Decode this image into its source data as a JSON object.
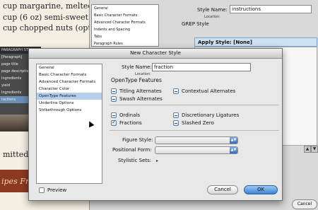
{
  "background_document": {
    "recipe_lines": [
      "cup margarine, melted",
      "cup (6 oz) semi-sweet choco",
      "cup chopped nuts (optional"
    ],
    "panel_title": "PARAGRAPH STYLES",
    "panel_items": [
      "[Paragraph]",
      "page title",
      "page description",
      "Ingredients",
      "yield",
      "Ingredients",
      "ractions"
    ],
    "by_text": "mitted by",
    "band_text": "ipes From J"
  },
  "background_dialog": {
    "categories": [
      "General",
      "Basic Character Formats",
      "Advanced Character Formats",
      "Indents and Spacing",
      "Tabs",
      "Paragraph Rules"
    ],
    "style_name_label": "Style Name:",
    "style_name_value": "instructions",
    "location_label": "Location:",
    "grep_label": "GREP Style",
    "apply_style": "Apply Style: [None]",
    "cancel_label": "Cancel"
  },
  "dialog": {
    "title": "New Character Style",
    "categories": [
      "General",
      "Basic Character Formats",
      "Advanced Character Formats",
      "Character Color",
      "OpenType Features",
      "Underline Options",
      "Strikethrough Options"
    ],
    "selected_category": "OpenType Features",
    "style_name_label": "Style Name:",
    "style_name_value": "fraction",
    "location_label": "Location:",
    "section_title": "OpenType Features",
    "checkboxes": {
      "titling": {
        "label": "Titling Alternates",
        "state": "mixed"
      },
      "contextual": {
        "label": "Contextual Alternates",
        "state": "mixed"
      },
      "swash": {
        "label": "Swash Alternates",
        "state": "mixed"
      },
      "ordinals": {
        "label": "Ordinals",
        "state": "mixed"
      },
      "discretionary": {
        "label": "Discretionary Ligatures",
        "state": "mixed"
      },
      "fractions": {
        "label": "Fractions",
        "state": "checked"
      },
      "slashed_zero": {
        "label": "Slashed Zero",
        "state": "mixed"
      }
    },
    "figure_style_label": "Figure Style:",
    "positional_form_label": "Positional Form:",
    "stylistic_sets_label": "Stylistic Sets:",
    "preview_label": "Preview",
    "cancel_label": "Cancel",
    "ok_label": "OK",
    "accent_color": "#3b82d6"
  }
}
